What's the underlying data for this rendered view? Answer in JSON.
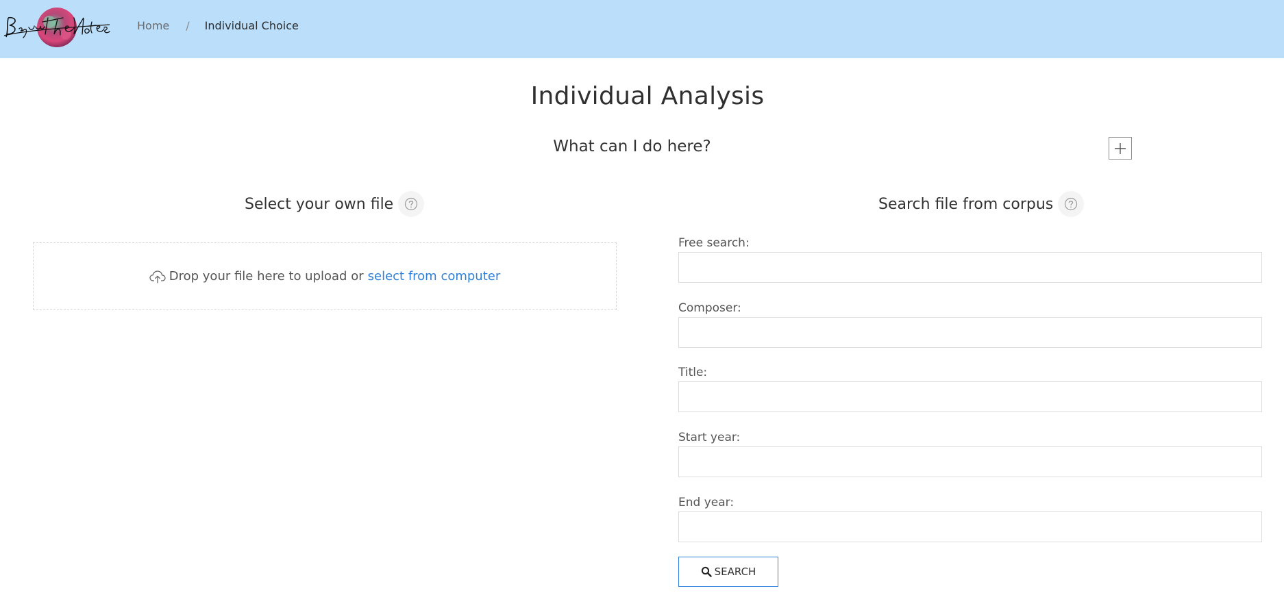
{
  "header": {
    "logo_text": "BeyondTheNotes",
    "breadcrumb": {
      "home": "Home",
      "separator": "/",
      "current": "Individual Choice"
    }
  },
  "main": {
    "title": "Individual Analysis",
    "faq": {
      "question": "What can I do here?",
      "expand_icon": "plus-icon"
    },
    "upload": {
      "heading": "Select your own file",
      "help_icon": "question-circle-icon",
      "upload_icon": "cloud-upload-icon",
      "drop_text": "Drop your file here to upload or",
      "select_link": "select from computer"
    },
    "corpus": {
      "heading": "Search file from corpus",
      "help_icon": "question-circle-icon",
      "fields": [
        {
          "label": "Free search:",
          "value": ""
        },
        {
          "label": "Composer:",
          "value": ""
        },
        {
          "label": "Title:",
          "value": ""
        },
        {
          "label": "Start year:",
          "value": ""
        },
        {
          "label": "End year:",
          "value": ""
        }
      ],
      "search_button": "SEARCH",
      "search_icon": "search-icon"
    }
  },
  "colors": {
    "header_bg": "#bbdefb",
    "link": "#2f80d8",
    "button_border": "#2f80d8"
  }
}
